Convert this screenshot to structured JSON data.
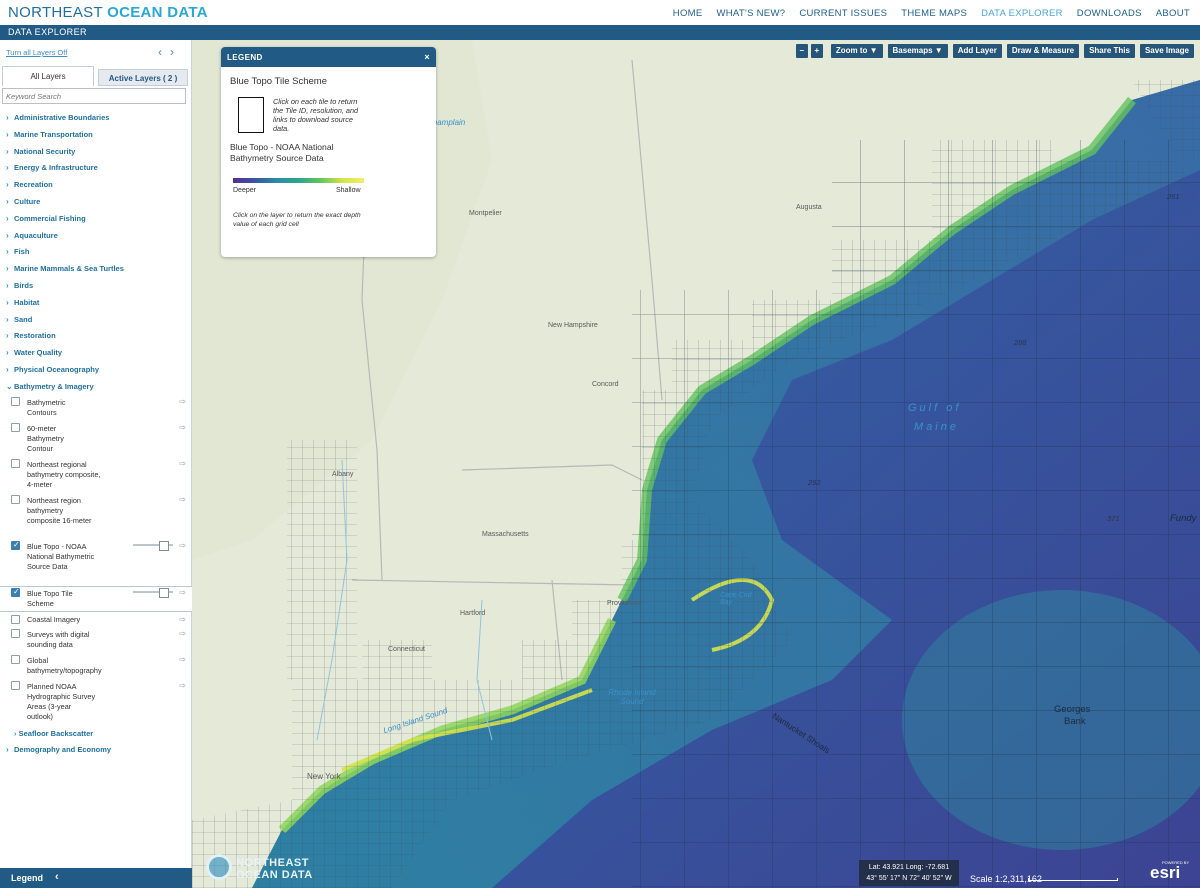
{
  "header": {
    "brand_main": "NORTHEAST",
    "brand_accent": "OCEAN DATA",
    "nav": [
      "HOME",
      "WHAT'S NEW?",
      "CURRENT ISSUES",
      "THEME MAPS",
      "DATA EXPLORER",
      "DOWNLOADS",
      "ABOUT"
    ],
    "active_nav": "DATA EXPLORER",
    "subtitle": "DATA EXPLORER"
  },
  "sidebar": {
    "turn_off_label": "Turn all Layers Off",
    "tab_all": "All Layers",
    "tab_active": "Active Layers ( 2 )",
    "search_placeholder": "Keyword Search",
    "categories": [
      "Administrative Boundaries",
      "Marine Transportation",
      "National Security",
      "Energy & Infrastructure",
      "Recreation",
      "Culture",
      "Commercial Fishing",
      "Aquaculture",
      "Fish",
      "Marine Mammals & Sea Turtles",
      "Birds",
      "Habitat",
      "Sand",
      "Restoration",
      "Water Quality",
      "Physical Oceanography",
      "Bathymetry & Imagery"
    ],
    "bathymetry_layers": [
      {
        "label": "Bathymetric Contours",
        "checked": false
      },
      {
        "label": "60-meter Bathymetry Contour",
        "checked": false
      },
      {
        "label": "Northeast regional bathymetry composite, 4-meter",
        "checked": false
      },
      {
        "label": "Northeast region bathymetry composite 16-meter",
        "checked": false
      },
      {
        "label": "Blue Topo - NOAA National Bathymetric Source Data",
        "checked": true
      },
      {
        "label": "Blue Topo Tile Scheme",
        "checked": true
      },
      {
        "label": "Coastal Imagery",
        "checked": false
      },
      {
        "label": "Surveys with digital sounding data",
        "checked": false
      },
      {
        "label": "Global bathymetry/topography",
        "checked": false
      },
      {
        "label": "Planned NOAA Hydrographic Survey Areas (3-year outlook)",
        "checked": false
      }
    ],
    "seafloor_label": "Seafloor Backscatter",
    "demography_label": "Demography and Economy",
    "footer_label": "Legend"
  },
  "toolbar": {
    "zoom_out": "–",
    "zoom_in": "+",
    "zoom_to": "Zoom to ▼",
    "basemaps": "Basemaps ▼",
    "add_layer": "Add Layer",
    "draw_measure": "Draw & Measure",
    "share": "Share This",
    "save": "Save Image"
  },
  "legend": {
    "header": "LEGEND",
    "title1": "Blue Topo Tile Scheme",
    "tile_text": "Click on each tile to return the Tile ID, resolution, and links to download source data.",
    "title2": "Blue Topo - NOAA National Bathymetry Source Data",
    "deeper": "Deeper",
    "shallow": "Shallow",
    "note": "Click on the layer to return the exact depth value of each grid cell"
  },
  "map": {
    "labels": {
      "champlain": "Champlain",
      "montpelier": "Montpelier",
      "augusta": "Augusta",
      "new_hampshire": "New Hampshire",
      "concord": "Concord",
      "albany": "Albany",
      "massachusetts": "Massachusetts",
      "hartford": "Hartford",
      "providence": "Providence",
      "connecticut": "Connecticut",
      "rhode_island_sound": "Rhode Island Sound",
      "long_island_sound": "Long Island Sound",
      "new_york": "New York",
      "cape_cod_bay": "Cape Cod Bay",
      "gulf_of_maine_1": "Gulf of",
      "gulf_of_maine_2": "Maine",
      "georges_1": "Georges",
      "georges_2": "Bank",
      "nantucket": "Nantucket Shoals",
      "fundy": "Fundy",
      "d261": "261",
      "d288": "288",
      "d292": "292",
      "d371": "371"
    },
    "coords_line1": "Lat: 43.921  Long: -72.681",
    "coords_line2": "43° 55' 17\" N 72° 40' 52\" W",
    "scale": "Scale 1:2,311,162",
    "watermark1": "NORTHEAST",
    "watermark2": "OCEAN DATA",
    "esri": "esri",
    "esri_powered": "POWERED BY"
  },
  "colors": {
    "nav_blue": "#215a85",
    "link_blue": "#1f6f9f",
    "ocean_deep": "#3a4e95",
    "ocean_mid": "#2b8ea4",
    "ocean_shallow": "#d9e34b"
  }
}
